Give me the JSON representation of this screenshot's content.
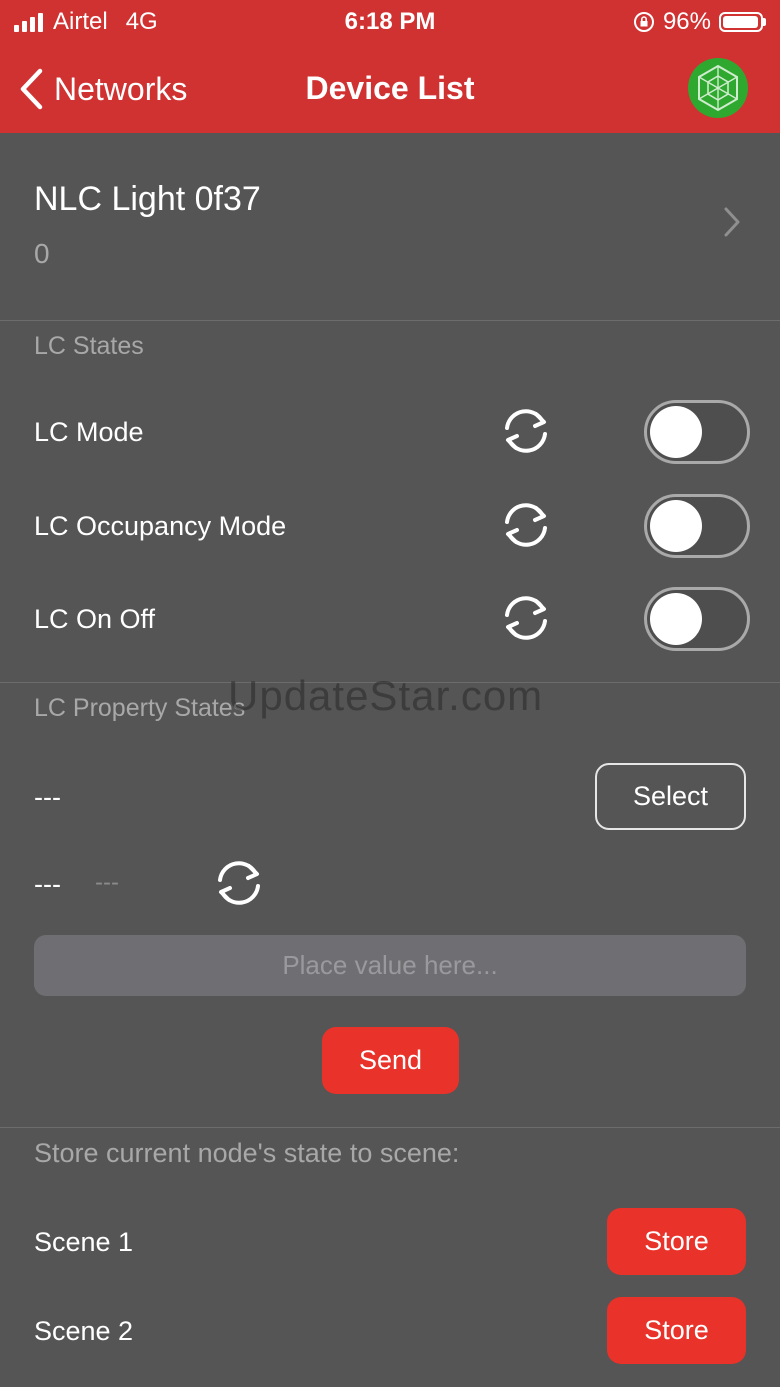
{
  "status_bar": {
    "carrier": "Airtel",
    "network": "4G",
    "time": "6:18 PM",
    "battery_percent": "96%",
    "battery_level": 0.96
  },
  "nav": {
    "back_label": "Networks",
    "title": "Device List"
  },
  "device": {
    "name": "NLC Light 0f37",
    "subtitle": "0"
  },
  "lc_states": {
    "section_label": "LC States",
    "rows": [
      {
        "label": "LC Mode",
        "on": false
      },
      {
        "label": "LC Occupancy Mode",
        "on": false
      },
      {
        "label": "LC On Off",
        "on": false
      }
    ]
  },
  "lc_property_states": {
    "section_label": "LC Property States",
    "property_value": "---",
    "select_label": "Select",
    "state_value": "---",
    "state_unit": "---",
    "input_placeholder": "Place value here...",
    "send_label": "Send"
  },
  "scenes": {
    "section_label": "Store current node's state to scene:",
    "items": [
      {
        "label": "Scene 1",
        "button": "Store"
      },
      {
        "label": "Scene 2",
        "button": "Store"
      }
    ]
  },
  "watermark": "UpdateStar.com",
  "colors": {
    "accent": "#d03232",
    "button_red": "#e8322a",
    "background": "#555555",
    "logo_green": "#2fa82f"
  }
}
